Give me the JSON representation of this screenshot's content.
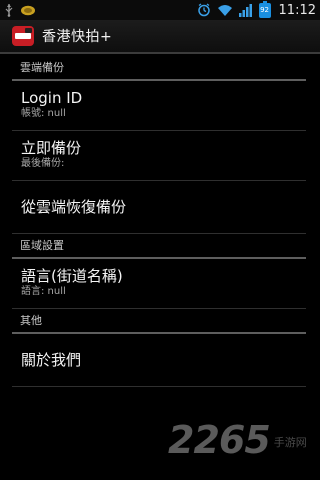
{
  "status_bar": {
    "time": "11:12",
    "battery_level": "92",
    "icons": [
      "usb-icon",
      "notification-icon",
      "alarm-icon",
      "wifi-icon",
      "signal-icon",
      "battery-icon"
    ]
  },
  "title_bar": {
    "app_title": "香港快拍+",
    "app_icon": "app-logo-icon"
  },
  "sections": [
    {
      "header": "雲端備份",
      "items": [
        {
          "title": "Login ID",
          "summary": "帳號: null"
        },
        {
          "title": "立即備份",
          "summary": "最後備份:"
        },
        {
          "title": "從雲端恢復備份",
          "summary": ""
        }
      ]
    },
    {
      "header": "區域設置",
      "items": [
        {
          "title": "語言(街道名稱)",
          "summary": "語言: null"
        }
      ]
    },
    {
      "header": "其他",
      "items": [
        {
          "title": "關於我們",
          "summary": ""
        }
      ]
    }
  ],
  "watermark": {
    "number": "2265",
    "text": "手游网"
  },
  "colors": {
    "background": "#000000",
    "divider": "#5e5e5e",
    "app_icon_red": "#c81e25",
    "battery_blue": "#1a8fe0"
  }
}
